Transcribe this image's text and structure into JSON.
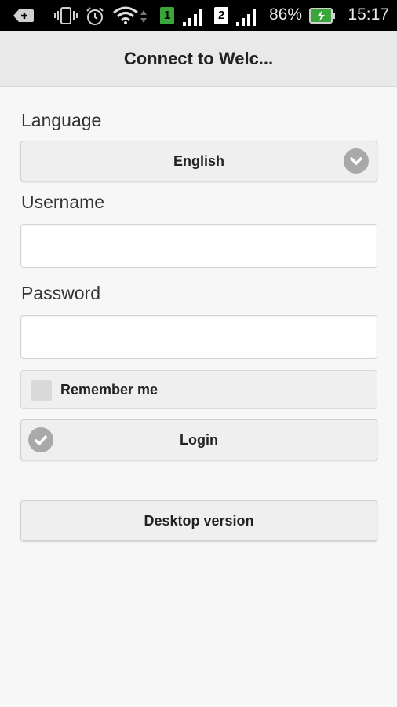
{
  "status_bar": {
    "battery_percent": "86%",
    "time": "15:17",
    "sim1": "1",
    "sim2": "2"
  },
  "header": {
    "title": "Connect to Welc..."
  },
  "form": {
    "language_label": "Language",
    "language_value": "English",
    "username_label": "Username",
    "username_value": "",
    "password_label": "Password",
    "password_value": "",
    "remember_label": "Remember me",
    "remember_checked": false,
    "login_label": "Login",
    "desktop_label": "Desktop version"
  }
}
